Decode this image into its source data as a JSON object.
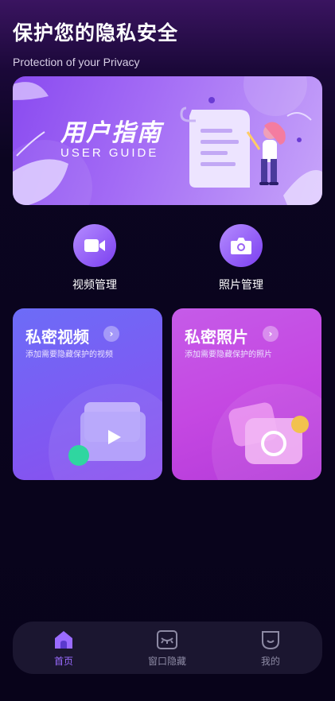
{
  "header": {
    "title": "保护您的隐私安全",
    "subtitle": "Protection of your Privacy"
  },
  "banner": {
    "title": "用户指南",
    "subtitle": "USER GUIDE"
  },
  "quick_actions": [
    {
      "label": "视频管理",
      "icon": "video-camera-icon"
    },
    {
      "label": "照片管理",
      "icon": "camera-icon"
    }
  ],
  "cards": [
    {
      "title": "私密视频",
      "desc": "添加需要隐藏保护的视频",
      "icon": "play-folder-icon"
    },
    {
      "title": "私密照片",
      "desc": "添加需要隐藏保护的照片",
      "icon": "photo-camera-icon"
    }
  ],
  "tabbar": {
    "items": [
      {
        "label": "首页",
        "icon": "home-icon",
        "active": true
      },
      {
        "label": "窗口隐藏",
        "icon": "closed-eye-window-icon",
        "active": false
      },
      {
        "label": "我的",
        "icon": "profile-face-icon",
        "active": false
      }
    ]
  },
  "colors": {
    "accent": "#9a6bff",
    "video_card": "#7264f5",
    "photo_card": "#c548e2",
    "background": "#08031a"
  }
}
